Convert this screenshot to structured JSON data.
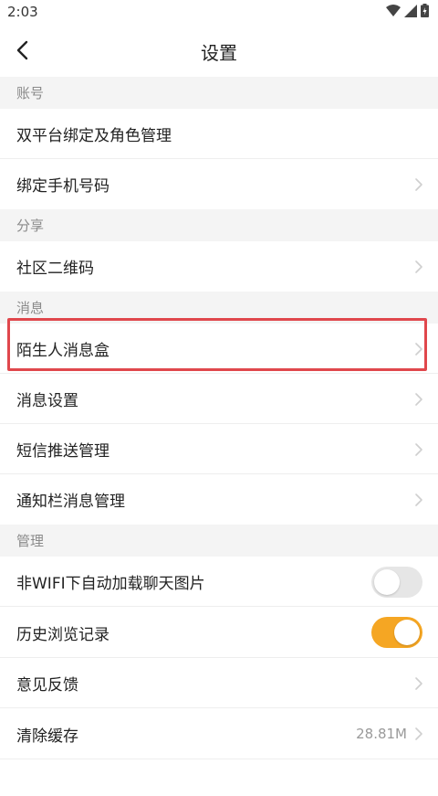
{
  "status": {
    "time": "2:03"
  },
  "nav": {
    "title": "设置"
  },
  "sections": {
    "account": "账号",
    "share": "分享",
    "message": "消息",
    "manage": "管理"
  },
  "rows": {
    "dual_platform": "双平台绑定及角色管理",
    "bind_phone": "绑定手机号码",
    "community_qr": "社区二维码",
    "stranger_box": "陌生人消息盒",
    "message_settings": "消息设置",
    "sms_push": "短信推送管理",
    "notify_bar": "通知栏消息管理",
    "non_wifi_images": "非WIFI下自动加载聊天图片",
    "history": "历史浏览记录",
    "feedback": "意见反馈",
    "clear_cache": "清除缓存",
    "cache_size": "28.81M"
  },
  "toggles": {
    "non_wifi_images": false,
    "history": true
  },
  "colors": {
    "accent": "#f5a623",
    "highlight": "#e0474c",
    "toggle_off": "#e6e6e6"
  }
}
